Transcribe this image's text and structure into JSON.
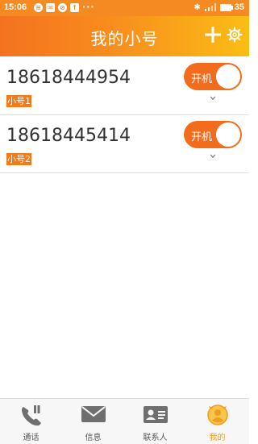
{
  "status_bar": {
    "time": "15:06",
    "battery": "35"
  },
  "header": {
    "title": "我的小号",
    "add_icon": "plus-icon",
    "settings_icon": "gear-icon"
  },
  "lines": [
    {
      "number": "18618444954",
      "tag": "小号1",
      "toggle_label": "开机"
    },
    {
      "number": "18618445414",
      "tag": "小号2",
      "toggle_label": "开机"
    }
  ],
  "tabs": [
    {
      "label": "通话",
      "icon": "phone-icon"
    },
    {
      "label": "信息",
      "icon": "message-icon"
    },
    {
      "label": "联系人",
      "icon": "contact-card-icon"
    },
    {
      "label": "我的",
      "icon": "profile-icon",
      "active": true
    }
  ],
  "colors": {
    "accent": "#f58a22",
    "toggle": "#f36c1c",
    "tag": "#f57a16",
    "active_tab": "#f39c1f"
  }
}
